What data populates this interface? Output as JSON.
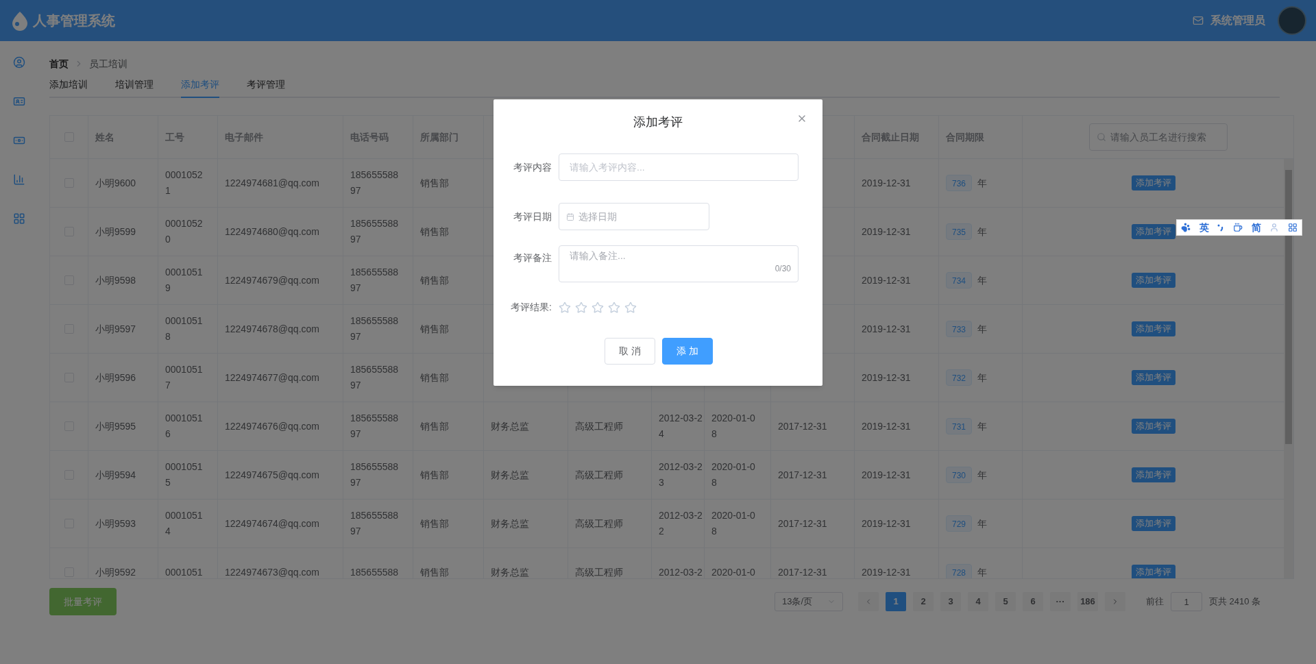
{
  "header": {
    "title": "人事管理系统",
    "user": "系统管理员"
  },
  "breadcrumb": [
    "首页",
    "员工培训"
  ],
  "tabs": [
    {
      "label": "添加培训",
      "selected": false
    },
    {
      "label": "培训管理",
      "selected": false
    },
    {
      "label": "添加考评",
      "selected": true
    },
    {
      "label": "考评管理",
      "selected": false
    }
  ],
  "table": {
    "select_all_checked": false,
    "columns": [
      {
        "label": "姓名"
      },
      {
        "label": "工号"
      },
      {
        "label": "电子邮件"
      },
      {
        "label": "电话号码"
      },
      {
        "label": "所属部门"
      },
      {},
      {},
      {},
      {},
      {},
      {
        "label": "合同截止日期"
      },
      {
        "label": "合同期限"
      }
    ],
    "search": {
      "placeholder": "请输入员工名进行搜索"
    },
    "rows": [
      {
        "checked": false,
        "name": "小明9600",
        "employee_no": "00010521",
        "email": "1224974681@qq.com",
        "phone": "18565558897",
        "department": "销售部",
        "contract_end": "2019-12-31",
        "term": "736",
        "term_unit": "年",
        "action": "添加考评"
      },
      {
        "checked": false,
        "name": "小明9599",
        "employee_no": "00010520",
        "email": "1224974680@qq.com",
        "phone": "18565558897",
        "department": "销售部",
        "contract_end": "2019-12-31",
        "term": "735",
        "term_unit": "年",
        "action": "添加考评"
      },
      {
        "checked": false,
        "name": "小明9598",
        "employee_no": "00010519",
        "email": "1224974679@qq.com",
        "phone": "18565558897",
        "department": "销售部",
        "contract_end": "2019-12-31",
        "term": "734",
        "term_unit": "年",
        "action": "添加考评"
      },
      {
        "checked": false,
        "name": "小明9597",
        "employee_no": "00010518",
        "email": "1224974678@qq.com",
        "phone": "18565558897",
        "department": "销售部",
        "contract_end": "2019-12-31",
        "term": "733",
        "term_unit": "年",
        "action": "添加考评"
      },
      {
        "checked": false,
        "name": "小明9596",
        "employee_no": "00010517",
        "email": "1224974677@qq.com",
        "phone": "18565558897",
        "department": "销售部",
        "contract_end": "2019-12-31",
        "term": "732",
        "term_unit": "年",
        "action": "添加考评"
      },
      {
        "checked": false,
        "name": "小明9595",
        "employee_no": "00010516",
        "email": "1224974676@qq.com",
        "phone": "18565558897",
        "department": "销售部",
        "position": "财务总监",
        "title": "高级工程师",
        "date_1": "2012-03-24",
        "date_2": "2020-01-08",
        "date_3": "2017-12-31",
        "contract_end": "2019-12-31",
        "term": "731",
        "term_unit": "年",
        "action": "添加考评"
      },
      {
        "checked": false,
        "name": "小明9594",
        "employee_no": "00010515",
        "email": "1224974675@qq.com",
        "phone": "18565558897",
        "department": "销售部",
        "position": "财务总监",
        "title": "高级工程师",
        "date_1": "2012-03-23",
        "date_2": "2020-01-08",
        "date_3": "2017-12-31",
        "contract_end": "2019-12-31",
        "term": "730",
        "term_unit": "年",
        "action": "添加考评"
      },
      {
        "checked": false,
        "name": "小明9593",
        "employee_no": "00010514",
        "email": "1224974674@qq.com",
        "phone": "18565558897",
        "department": "销售部",
        "position": "财务总监",
        "title": "高级工程师",
        "date_1": "2012-03-22",
        "date_2": "2020-01-08",
        "date_3": "2017-12-31",
        "contract_end": "2019-12-31",
        "term": "729",
        "term_unit": "年",
        "action": "添加考评"
      },
      {
        "checked": false,
        "name": "小明9592",
        "employee_no": "0001051",
        "email": "1224974673@qq.com",
        "phone": "185655588",
        "department": "销售部",
        "position": "财务总监",
        "title": "高级工程师",
        "date_1": "2012-03-2",
        "date_2": "2020-01-0",
        "date_3": "2017-12-31",
        "contract_end": "2019-12-31",
        "term": "728",
        "term_unit": "年",
        "action": "添加考评"
      }
    ]
  },
  "batch_button": "批量考评",
  "pagination": {
    "page_size": "13条/页",
    "pages": [
      {
        "label": "1",
        "selected": true
      },
      {
        "label": "2",
        "selected": false
      },
      {
        "label": "3",
        "selected": false
      },
      {
        "label": "4",
        "selected": false
      },
      {
        "label": "5",
        "selected": false
      },
      {
        "label": "6",
        "selected": false
      },
      {
        "label": "···",
        "selected": false
      },
      {
        "label": "186",
        "selected": false
      }
    ],
    "goto_label": "前往",
    "goto_value": "1",
    "total": "页共 2410 条"
  },
  "dialog": {
    "title": "添加考评",
    "fields": [
      {
        "kind": "input",
        "label": "考评内容",
        "placeholder": "请输入考评内容..."
      },
      {
        "kind": "date",
        "label": "考评日期",
        "placeholder": "选择日期"
      },
      {
        "kind": "textarea",
        "label": "考评备注",
        "placeholder": "请输入备注...",
        "counter": "0/30"
      },
      {
        "kind": "rating",
        "label": "考评结果:",
        "stars": 0
      }
    ],
    "buttons": [
      {
        "kind": "default",
        "label": "取 消"
      },
      {
        "kind": "primary",
        "label": "添 加"
      }
    ]
  },
  "ime_toolbar": {
    "mode": "英",
    "script": "简"
  }
}
